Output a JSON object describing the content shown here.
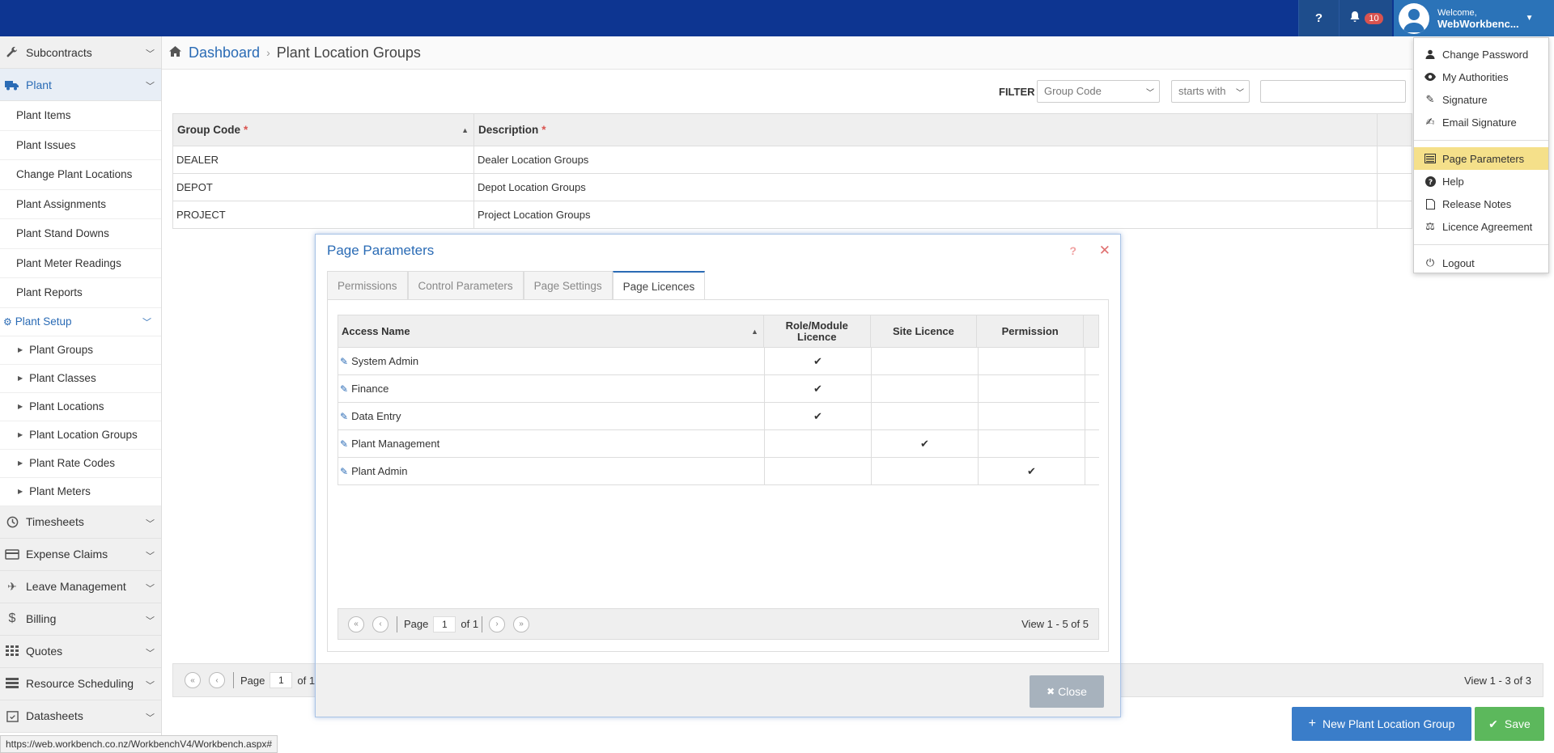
{
  "topbar": {
    "help_label": "?",
    "notification_count": "10",
    "welcome": "Welcome,",
    "username": "WebWorkbenc..."
  },
  "sidebar": {
    "groups_top": [
      {
        "label": "Subcontracts",
        "icon": "wrench-icon"
      },
      {
        "label": "Plant",
        "icon": "truck-icon"
      }
    ],
    "plant_items": [
      "Plant Items",
      "Plant Issues",
      "Change Plant Locations",
      "Plant Assignments",
      "Plant Stand Downs",
      "Plant Meter Readings",
      "Plant Reports"
    ],
    "setup_label": "Plant Setup",
    "setup_items": [
      "Plant Groups",
      "Plant Classes",
      "Plant Locations",
      "Plant Location Groups",
      "Plant Rate Codes",
      "Plant Meters"
    ],
    "groups_bottom": [
      {
        "label": "Timesheets",
        "icon": "clock-icon"
      },
      {
        "label": "Expense Claims",
        "icon": "credit-card-icon"
      },
      {
        "label": "Leave Management",
        "icon": "plane-icon"
      },
      {
        "label": "Billing",
        "icon": "dollar-icon"
      },
      {
        "label": "Quotes",
        "icon": "grid-icon"
      },
      {
        "label": "Resource Scheduling",
        "icon": "tasks-icon"
      },
      {
        "label": "Datasheets",
        "icon": "calendar-check-icon"
      }
    ]
  },
  "breadcrumb": {
    "home_link": "Dashboard",
    "current": "Plant Location Groups"
  },
  "filter": {
    "label": "FILTER",
    "field": "Group Code",
    "operator": "starts with",
    "value": ""
  },
  "grid": {
    "columns": [
      "Group Code",
      "Description"
    ],
    "rows": [
      {
        "code": "DEALER",
        "desc": "Dealer Location Groups"
      },
      {
        "code": "DEPOT",
        "desc": "Depot Location Groups"
      },
      {
        "code": "PROJECT",
        "desc": "Project Location Groups"
      }
    ],
    "pager": {
      "page_label": "Page",
      "page": "1",
      "of": "of 1",
      "view": "View 1 - 3 of 3"
    }
  },
  "buttons": {
    "new": "New Plant Location Group",
    "save": "Save"
  },
  "statusbar": "https://web.workbench.co.nz/WorkbenchV4/Workbench.aspx#",
  "modal": {
    "title": "Page Parameters",
    "tabs": [
      "Permissions",
      "Control Parameters",
      "Page Settings",
      "Page Licences"
    ],
    "active_tab": 3,
    "columns": {
      "access": "Access Name",
      "role_1": "Role/Module",
      "role_2": "Licence",
      "site": "Site Licence",
      "perm": "Permission"
    },
    "rows": [
      {
        "name": "System Admin",
        "role": "✔",
        "site": "",
        "perm": ""
      },
      {
        "name": "Finance",
        "role": "✔",
        "site": "",
        "perm": ""
      },
      {
        "name": "Data Entry",
        "role": "✔",
        "site": "",
        "perm": ""
      },
      {
        "name": "Plant Management",
        "role": "",
        "site": "✔",
        "perm": ""
      },
      {
        "name": "Plant Admin",
        "role": "",
        "site": "",
        "perm": "✔"
      }
    ],
    "pager": {
      "page_label": "Page",
      "page": "1",
      "of": "of 1",
      "view": "View 1 - 5 of 5"
    },
    "close_label": "Close"
  },
  "user_menu": {
    "group1": [
      {
        "label": "Change Password",
        "icon": "user-icon"
      },
      {
        "label": "My Authorities",
        "icon": "eye-icon"
      },
      {
        "label": "Signature",
        "icon": "pencil-icon"
      },
      {
        "label": "Email Signature",
        "icon": "edit-icon"
      }
    ],
    "group2": [
      {
        "label": "Page Parameters",
        "icon": "list-icon"
      },
      {
        "label": "Help",
        "icon": "question-circle-icon"
      },
      {
        "label": "Release Notes",
        "icon": "file-icon"
      },
      {
        "label": "Licence Agreement",
        "icon": "balance-scale-icon"
      }
    ],
    "logout": "Logout",
    "highlight_color": "#f5e08a"
  }
}
